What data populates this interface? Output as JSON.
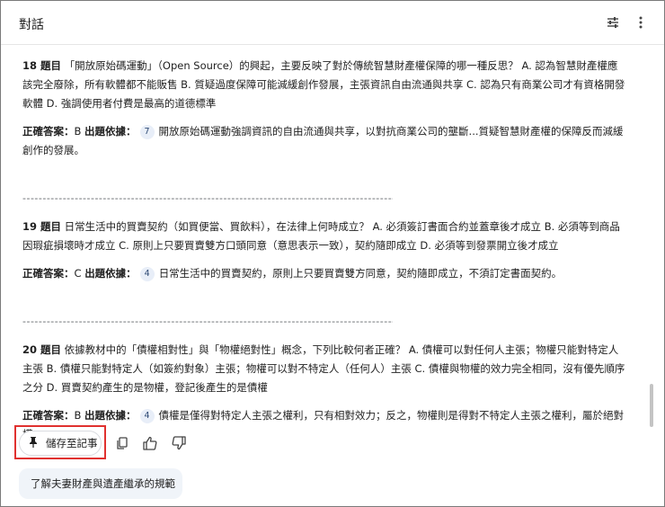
{
  "header": {
    "title": "對話",
    "tune_icon": "tune-icon",
    "more_icon": "more-vert-icon"
  },
  "labels": {
    "answer": "正確答案：",
    "source": "出題依據："
  },
  "questions": [
    {
      "number": "18 題目",
      "text": "「開放原始碼運動」（Open Source）的興起，主要反映了對於傳統智慧財產權保障的哪一種反思？ A. 認為智慧財產權應該完全廢除，所有軟體都不能販售 B. 質疑過度保障可能減緩創作發展，主張資訊自由流通與共享 C. 認為只有商業公司才有資格開發軟體 D. 強調使用者付費是最高的道德標準",
      "answer": "B",
      "source_num": "7",
      "source_text": "開放原始碼運動強調資訊的自由流通與共享，以對抗商業公司的壟斷...質疑智慧財產權的保障反而減緩創作的發展。"
    },
    {
      "number": "19 題目",
      "text": "日常生活中的買賣契約（如買便當、買飲料），在法律上何時成立？ A. 必須簽訂書面合約並蓋章後才成立 B. 必須等到商品因瑕疵損壞時才成立 C. 原則上只要買賣雙方口頭同意（意思表示一致），契約隨即成立 D. 必須等到發票開立後才成立",
      "answer": "C",
      "source_num": "4",
      "source_text": "日常生活中的買賣契約，原則上只要買賣雙方同意，契約隨即成立，不須訂定書面契約。"
    },
    {
      "number": "20 題目",
      "text": "依據教材中的「債權相對性」與「物權絕對性」概念，下列比較何者正確？ A. 債權可以對任何人主張；物權只能對特定人主張 B. 債權只能對特定人（如簽約對象）主張；物權可以對不特定人（任何人）主張 C. 債權與物權的效力完全相同，沒有優先順序之分 D. 買賣契約產生的是物權，登記後產生的是債權",
      "answer": "B",
      "source_num": "4",
      "source_text": "債權是僅得對特定人主張之權利，只有相對效力；反之，物權則是得對不特定人主張之權利，屬於絕對權。"
    }
  ],
  "divider": "---------------------------------------------------------------------------------------------------",
  "actions": {
    "save_label": "儲存至記事",
    "pin_icon": "pin-icon",
    "copy_icon": "copy-icon",
    "thumb_up_icon": "thumb-up-icon",
    "thumb_down_icon": "thumb-down-icon"
  },
  "suggestion": "了解夫妻財產與遺產繼承的規範",
  "colors": {
    "highlight_border": "#e0312f",
    "badge_bg": "#e8eef8",
    "chip_bg": "#f0f4f9"
  }
}
